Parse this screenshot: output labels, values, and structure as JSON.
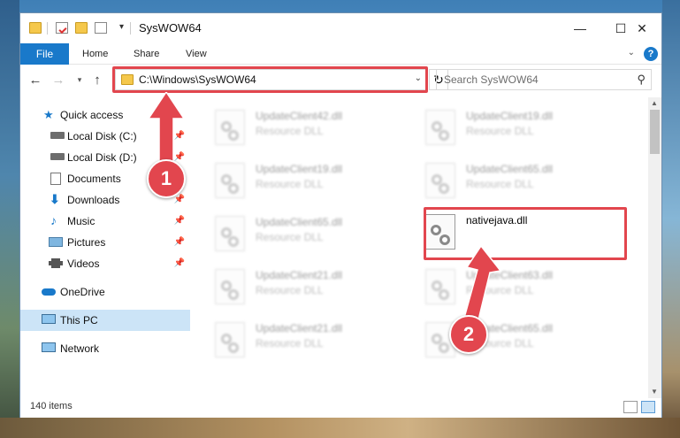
{
  "window": {
    "title": "SysWOW64"
  },
  "controls": {
    "minimize": "—",
    "maximize": "☐",
    "close": "✕"
  },
  "ribbon": {
    "file": "File",
    "tabs": [
      "Home",
      "Share",
      "View"
    ],
    "help": "?"
  },
  "address": {
    "path": "C:\\Windows\\SysWOW64"
  },
  "search": {
    "placeholder": "Search SysWOW64"
  },
  "sidebar": {
    "items": [
      {
        "label": "Quick access",
        "icon": "star-icon",
        "pinned": false
      },
      {
        "label": "Local Disk (C:)",
        "icon": "drive-icon",
        "pinned": true
      },
      {
        "label": "Local Disk (D:)",
        "icon": "drive-icon",
        "pinned": true
      },
      {
        "label": "Documents",
        "icon": "documents-icon",
        "pinned": true
      },
      {
        "label": "Downloads",
        "icon": "download-icon",
        "pinned": true
      },
      {
        "label": "Music",
        "icon": "music-icon",
        "pinned": true
      },
      {
        "label": "Pictures",
        "icon": "pictures-icon",
        "pinned": true
      },
      {
        "label": "Videos",
        "icon": "videos-icon",
        "pinned": true
      },
      {
        "label": "OneDrive",
        "icon": "cloud-icon",
        "pinned": false
      },
      {
        "label": "This PC",
        "icon": "computer-icon",
        "pinned": false,
        "selected": true
      },
      {
        "label": "Network",
        "icon": "network-icon",
        "pinned": false
      }
    ]
  },
  "files": [
    {
      "name": "UpdateClient42.dll",
      "type": "Resource DLL"
    },
    {
      "name": "UpdateClient19.dll",
      "type": "Resource DLL"
    },
    {
      "name": "UpdateClient19.dll",
      "type": "Resource DLL"
    },
    {
      "name": "UpdateClient65.dll",
      "type": "Resource DLL"
    },
    {
      "name": "UpdateClient65.dll",
      "type": "Resource DLL"
    },
    {
      "name": "nativejava.dll",
      "type": ""
    },
    {
      "name": "UpdateClient21.dll",
      "type": "Resource DLL"
    },
    {
      "name": "UpdateClient63.dll",
      "type": "Resource DLL"
    },
    {
      "name": "UpdateClient21.dll",
      "type": "Resource DLL"
    },
    {
      "name": "UpdateClient65.dll",
      "type": "Resource DLL"
    }
  ],
  "status": {
    "count": "140 items"
  },
  "annotations": {
    "step1": "1",
    "step2": "2",
    "color": "#e2464e"
  }
}
